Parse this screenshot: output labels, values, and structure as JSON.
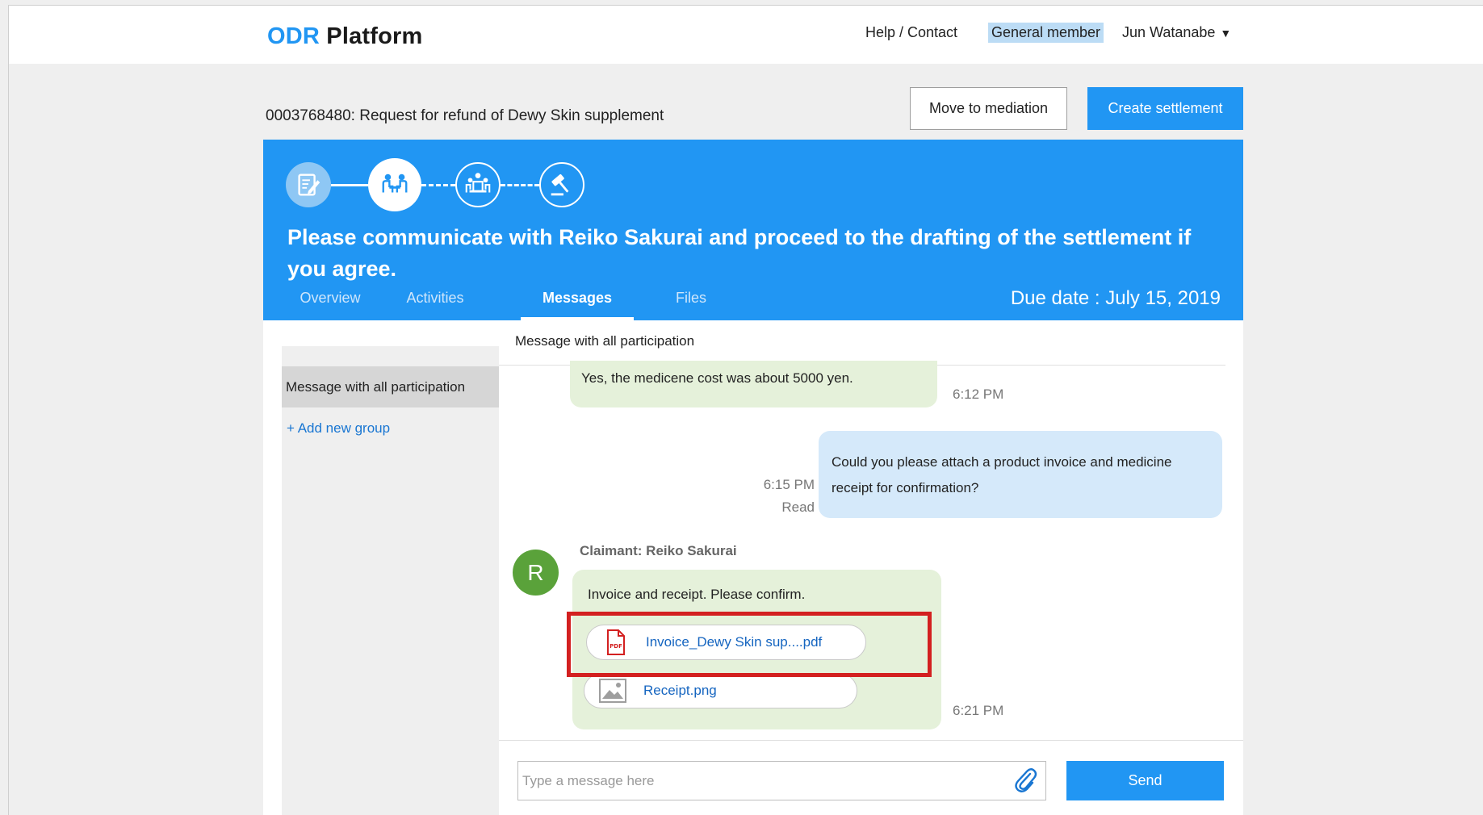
{
  "header": {
    "logo_prefix": "ODR",
    "logo_suffix": " Platform",
    "help_link": "Help / Contact",
    "member_badge": "General member",
    "user_name": "Jun Watanabe",
    "user_caret": "▼"
  },
  "case": {
    "title": "0003768480: Request for refund of Dewy Skin supplement",
    "move_to_mediation": "Move to mediation",
    "create_settlement": "Create settlement"
  },
  "banner": {
    "message": "Please communicate with Reiko Sakurai and proceed to the drafting of the settlement if you agree.",
    "due_date": "Due date : July 15, 2019",
    "tabs": [
      {
        "label": "Overview",
        "active": false
      },
      {
        "label": "Activities",
        "active": false
      },
      {
        "label": "Messages",
        "active": true
      },
      {
        "label": "Files",
        "active": false
      }
    ],
    "steps": [
      "edit-document-icon",
      "negotiation-icon",
      "mediation-icon",
      "gavel-icon"
    ]
  },
  "sidebar": {
    "group_selected": "Message with all participation",
    "add_group": "+ Add new group"
  },
  "chat": {
    "header": "Message with all participation",
    "messages": [
      {
        "text": "Yes, the medicene cost was about 5000 yen.",
        "time": "6:12 PM"
      },
      {
        "text": "Could you please attach a product invoice and medicine receipt for confirmation?",
        "time": "6:15 PM",
        "status": "Read"
      },
      {
        "sender": "Claimant: Reiko Sakurai",
        "avatar": "R",
        "text": "Invoice and receipt. Please confirm.",
        "time": "6:21 PM",
        "attachments": [
          {
            "name": "Invoice_Dewy Skin sup....pdf",
            "icon": "pdf-file-icon"
          },
          {
            "name": "Receipt.png",
            "icon": "image-file-icon"
          }
        ]
      }
    ],
    "input_placeholder": "Type a message here",
    "send_label": "Send"
  },
  "colors": {
    "primary": "#2196f3",
    "highlight": "#d32020",
    "green_bubble": "#e5f1da",
    "blue_bubble": "#d5e9fa",
    "avatar": "#5aa23a"
  }
}
